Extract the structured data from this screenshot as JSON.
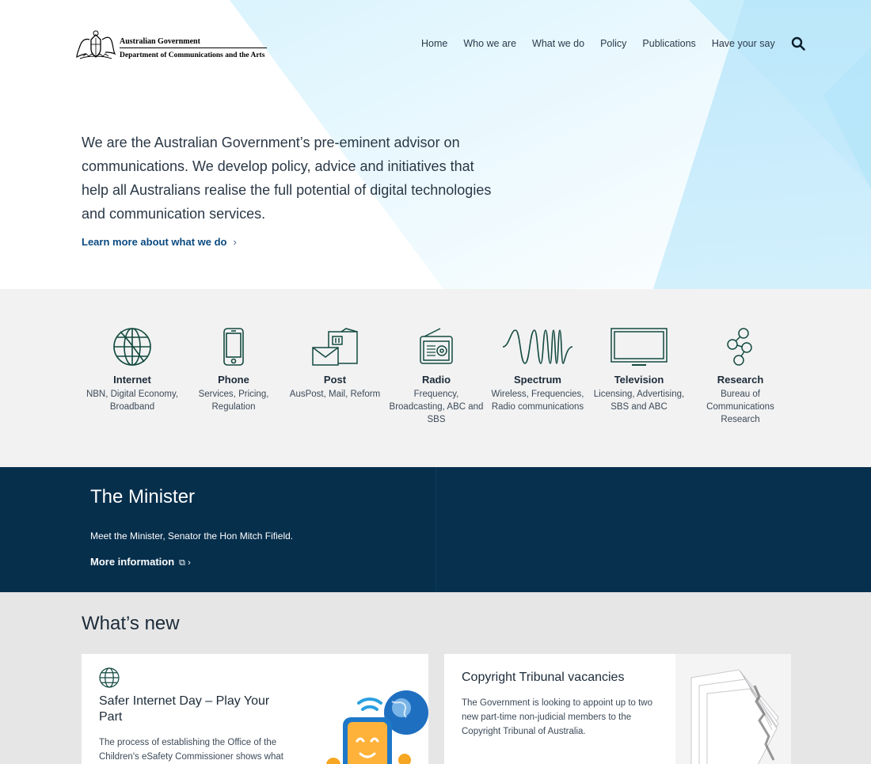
{
  "header": {
    "logo": {
      "line1": "Australian Government",
      "line2": "Department of Communications and the Arts"
    },
    "nav": [
      {
        "label": "Home"
      },
      {
        "label": "Who we are"
      },
      {
        "label": "What we do"
      },
      {
        "label": "Policy"
      },
      {
        "label": "Publications"
      },
      {
        "label": "Have your say"
      }
    ],
    "search_icon": "search-icon"
  },
  "hero": {
    "intro": "We are the Australian Government’s pre-eminent advisor on communications. We develop policy, advice and initiatives that help all Australians realise the full potential of digital technologies and communication services.",
    "link_label": "Learn more about what we do",
    "link_chevron": "›"
  },
  "topics": [
    {
      "name": "Internet",
      "desc": "NBN, Digital Economy, Broadband",
      "icon": "globe-icon"
    },
    {
      "name": "Phone",
      "desc": "Services, Pricing, Regulation",
      "icon": "phone-icon"
    },
    {
      "name": "Post",
      "desc": "AusPost, Mail, Reform",
      "icon": "post-icon"
    },
    {
      "name": "Radio",
      "desc": "Frequency, Broadcasting, ABC and SBS",
      "icon": "radio-icon"
    },
    {
      "name": "Spectrum",
      "desc": "Wireless, Frequencies, Radio communications",
      "icon": "wave-icon"
    },
    {
      "name": "Television",
      "desc": "Licensing, Advertising, SBS and ABC",
      "icon": "tv-icon"
    },
    {
      "name": "Research",
      "desc": "Bureau of Communications Research",
      "icon": "molecule-icon"
    }
  ],
  "minister": {
    "title": "The Minister",
    "text": "Meet the Minister, Senator the Hon Mitch Fifield.",
    "link_label": "More information",
    "link_ext": "⧉ ›"
  },
  "whats_new": {
    "heading": "What’s new",
    "cards": [
      {
        "title": "Safer Internet Day – Play Your Part",
        "text": "The process of establishing the Office of the Children's eSafety Commissioner shows what",
        "icon": "globe-icon"
      },
      {
        "title": "Copyright Tribunal vacancies",
        "text": "The Government is looking to appoint up to two new part-time non-judicial members to the Copyright Tribunal of Australia."
      }
    ]
  },
  "colors": {
    "accent_link": "#0a4a80",
    "minister_bg": "#062f4c",
    "topics_bg": "#f2f2f2",
    "news_bg": "#e6e6e6",
    "hero_blue": "#c6ecfb"
  }
}
